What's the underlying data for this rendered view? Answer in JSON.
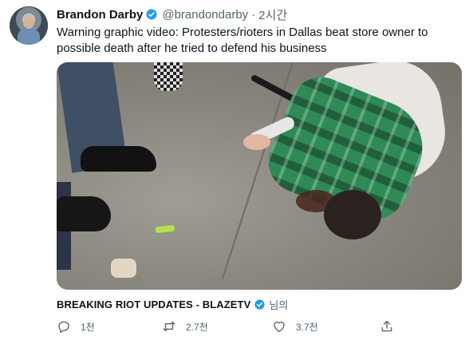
{
  "tweet": {
    "display_name": "Brandon Darby",
    "handle": "@brandondarby",
    "separator": "·",
    "time": "2시간",
    "text": "Warning graphic video: Protesters/rioters in Dallas beat store owner to possible death after he tried to defend his business",
    "verified": true
  },
  "card": {
    "title": "BREAKING RIOT UPDATES - BLAZETV",
    "suffix": "님의"
  },
  "actions": {
    "reply_count": "1천",
    "retweet_count": "2.7천",
    "like_count": "3.7천"
  },
  "colors": {
    "verified_blue": "#1d9bf0",
    "secondary_text": "#536471",
    "primary_text": "#0f1419"
  },
  "icons": {
    "verified": "verified-badge-icon",
    "reply": "reply-icon",
    "retweet": "retweet-icon",
    "like": "heart-icon",
    "share": "share-icon"
  }
}
